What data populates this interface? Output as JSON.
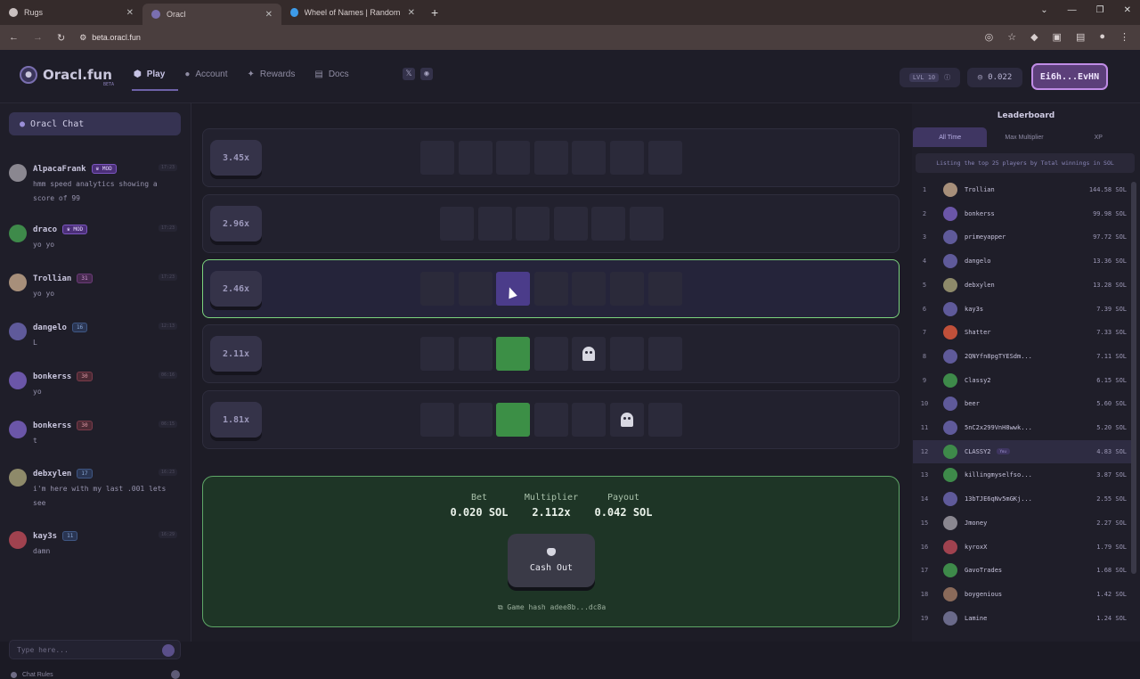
{
  "browser": {
    "tabs": [
      {
        "title": "Rugs",
        "color": "#c9c0c0"
      },
      {
        "title": "Oracl",
        "color": "#7a6fb0"
      },
      {
        "title": "Wheel of Names | Random nam",
        "color": "#3d9be9"
      }
    ],
    "url": "beta.oracl.fun"
  },
  "header": {
    "logo": "Oracl.fun",
    "beta": "BETA",
    "nav": [
      "Play",
      "Account",
      "Rewards",
      "Docs"
    ],
    "level": "LVL 10",
    "balance": "0.022",
    "wallet": "Ei6h...EvHN"
  },
  "chat": {
    "title": "Oracl Chat",
    "input_placeholder": "Type here...",
    "rules_label": "Chat Rules",
    "messages": [
      {
        "name": "AlpacaFrank",
        "badge": "MOD",
        "badge_type": "mod",
        "text": "hmm speed analytics showing a score of 99",
        "time": "17:23",
        "avatar": "#8a8790"
      },
      {
        "name": "draco",
        "badge": "MOD",
        "badge_type": "mod",
        "text": "yo yo",
        "time": "17:23",
        "avatar": "#3e8a4a"
      },
      {
        "name": "Trollian",
        "badge": "31",
        "badge_type": "lvlp",
        "text": "yo yo",
        "time": "17:23",
        "avatar": "#a78f7a"
      },
      {
        "name": "dangelo",
        "badge": "16",
        "badge_type": "lvlb",
        "text": "L",
        "time": "12:13",
        "avatar": "#5f5a9a"
      },
      {
        "name": "bonkerss",
        "badge": "30",
        "badge_type": "lvlr",
        "text": "yo",
        "time": "06:16",
        "avatar": "#6b56a8"
      },
      {
        "name": "bonkerss",
        "badge": "30",
        "badge_type": "lvlr",
        "text": "t",
        "time": "06:15",
        "avatar": "#6b56a8"
      },
      {
        "name": "debxylen",
        "badge": "17",
        "badge_type": "lvlb",
        "text": "i'm here with my last .001 lets see",
        "time": "16:23",
        "avatar": "#8e8a6a"
      },
      {
        "name": "kay3s",
        "badge": "11",
        "badge_type": "lvlb",
        "text": "damn",
        "time": "16:29",
        "avatar": "#a0424f"
      }
    ]
  },
  "game": {
    "rows": [
      {
        "multiplier": "3.45x",
        "state": "idle"
      },
      {
        "multiplier": "2.96x",
        "state": "idle"
      },
      {
        "multiplier": "2.46x",
        "state": "active"
      },
      {
        "multiplier": "2.11x",
        "state": "revealed"
      },
      {
        "multiplier": "1.81x",
        "state": "revealed"
      }
    ],
    "bet_label": "Bet",
    "bet_value": "0.020 SOL",
    "mult_label": "Multiplier",
    "mult_value": "2.112x",
    "payout_label": "Payout",
    "payout_value": "0.042 SOL",
    "cashout_label": "Cash Out",
    "hash_label": "Game hash adee8b...dc8a"
  },
  "leaderboard": {
    "title": "Leaderboard",
    "tabs": [
      "All Time",
      "Max Multiplier",
      "XP"
    ],
    "note": "Listing the top 25 players by Total winnings in SOL",
    "rows": [
      {
        "rank": "1",
        "name": "Trollian",
        "win": "144.58 SOL",
        "avatar": "#a78f7a"
      },
      {
        "rank": "2",
        "name": "bonkerss",
        "win": "99.98 SOL",
        "avatar": "#6b56a8"
      },
      {
        "rank": "3",
        "name": "primeyapper",
        "win": "97.72 SOL",
        "avatar": "#5f5a9a"
      },
      {
        "rank": "4",
        "name": "dangelo",
        "win": "13.36 SOL",
        "avatar": "#5f5a9a"
      },
      {
        "rank": "5",
        "name": "debxylen",
        "win": "13.28 SOL",
        "avatar": "#8e8a6a"
      },
      {
        "rank": "6",
        "name": "kay3s",
        "win": "7.39 SOL",
        "avatar": "#5f5a9a"
      },
      {
        "rank": "7",
        "name": "Shatter",
        "win": "7.33 SOL",
        "avatar": "#c0503a"
      },
      {
        "rank": "8",
        "name": "2QNYfn8pgTYESdm...",
        "win": "7.11 SOL",
        "avatar": "#5f5a9a"
      },
      {
        "rank": "9",
        "name": "Classy2",
        "win": "6.15 SOL",
        "avatar": "#3e8a4a"
      },
      {
        "rank": "10",
        "name": "beer",
        "win": "5.60 SOL",
        "avatar": "#5f5a9a"
      },
      {
        "rank": "11",
        "name": "5nC2x299VnH8wwk...",
        "win": "5.20 SOL",
        "avatar": "#5f5a9a"
      },
      {
        "rank": "12",
        "name": "CLASSY2",
        "win": "4.83 SOL",
        "avatar": "#3e8a4a",
        "you": "You"
      },
      {
        "rank": "13",
        "name": "killingmyselfso...",
        "win": "3.87 SOL",
        "avatar": "#3e8a4a"
      },
      {
        "rank": "14",
        "name": "13bTJE6qNv5mGKj...",
        "win": "2.55 SOL",
        "avatar": "#5f5a9a"
      },
      {
        "rank": "15",
        "name": "Jmoney",
        "win": "2.27 SOL",
        "avatar": "#8a8790"
      },
      {
        "rank": "16",
        "name": "kyroxX",
        "win": "1.79 SOL",
        "avatar": "#a0424f"
      },
      {
        "rank": "17",
        "name": "GavoTrades",
        "win": "1.68 SOL",
        "avatar": "#3e8a4a"
      },
      {
        "rank": "18",
        "name": "boygenious",
        "win": "1.42 SOL",
        "avatar": "#8a6a5a"
      },
      {
        "rank": "19",
        "name": "Lamine",
        "win": "1.24 SOL",
        "avatar": "#6a6a8a"
      }
    ]
  }
}
